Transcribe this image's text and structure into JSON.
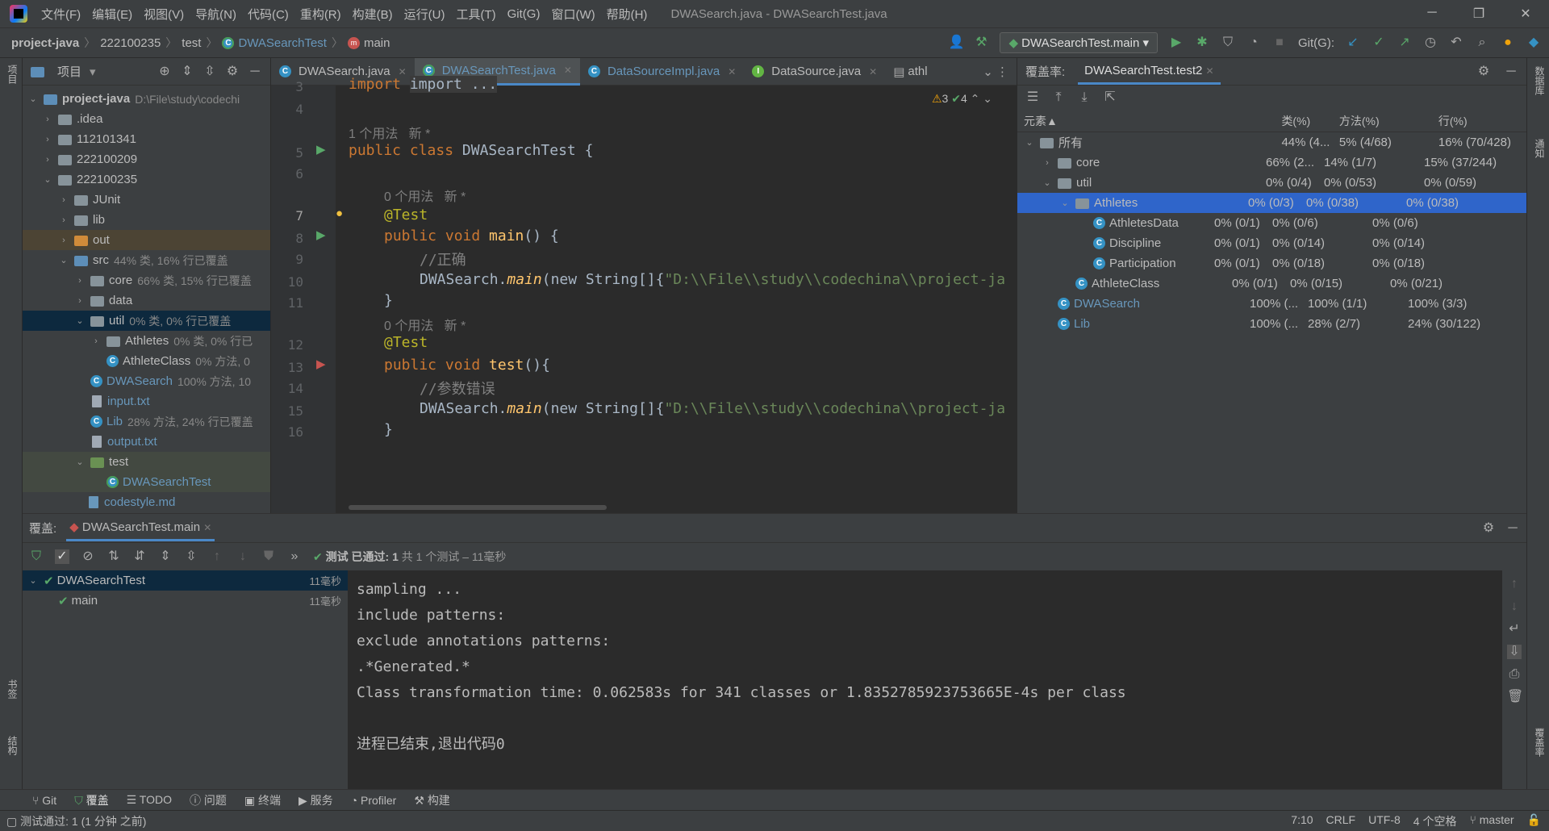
{
  "window": {
    "title": "DWASearch.java - DWASearchTest.java"
  },
  "menu": [
    "文件(F)",
    "编辑(E)",
    "视图(V)",
    "导航(N)",
    "代码(C)",
    "重构(R)",
    "构建(B)",
    "运行(U)",
    "工具(T)",
    "Git(G)",
    "窗口(W)",
    "帮助(H)"
  ],
  "breadcrumb": {
    "project": "project-java",
    "dir1": "222100235",
    "dir2": "test",
    "cls": "DWASearchTest",
    "method": "main"
  },
  "run_config": "DWASearchTest.main",
  "git_label": "Git(G):",
  "project_panel": {
    "title": "项目",
    "root": "project-java",
    "root_path": "D:\\File\\study\\codechi",
    "items": [
      {
        "label": ".idea",
        "note": ""
      },
      {
        "label": "112101341",
        "note": ""
      },
      {
        "label": "222100209",
        "note": ""
      },
      {
        "label": "222100235",
        "note": ""
      },
      {
        "label": "JUnit",
        "note": ""
      },
      {
        "label": "lib",
        "note": ""
      },
      {
        "label": "out",
        "note": ""
      },
      {
        "label": "src",
        "note": "44% 类, 16% 行已覆盖"
      },
      {
        "label": "core",
        "note": "66% 类, 15% 行已覆盖"
      },
      {
        "label": "data",
        "note": ""
      },
      {
        "label": "util",
        "note": "0% 类, 0% 行已覆盖"
      },
      {
        "label": "Athletes",
        "note": "0% 类, 0% 行已"
      },
      {
        "label": "AthleteClass",
        "note": "0% 方法, 0"
      },
      {
        "label": "DWASearch",
        "note": "100% 方法, 10"
      },
      {
        "label": "input.txt",
        "note": ""
      },
      {
        "label": "Lib",
        "note": "28% 方法, 24% 行已覆盖"
      },
      {
        "label": "output.txt",
        "note": ""
      },
      {
        "label": "test",
        "note": ""
      },
      {
        "label": "DWASearchTest",
        "note": ""
      },
      {
        "label": "codestyle.md",
        "note": ""
      }
    ]
  },
  "editor_tabs": [
    "DWASearch.java",
    "DWASearchTest.java",
    "DataSourceImpl.java",
    "DataSource.java",
    "athl"
  ],
  "inspections": {
    "warnings": "3",
    "ok": "4"
  },
  "code": {
    "l3": "import ...",
    "hint1": "1 个用法   新 *",
    "l5a": "public class ",
    "l5b": "DWASearchTest ",
    "l5c": "{",
    "hint2": "0 个用法   新 *",
    "l7": "@Test",
    "l8a": "public void ",
    "l8b": "main",
    "l8c": "() {",
    "l9": "//正确",
    "l10a": "DWASearch.",
    "l10b": "main",
    "l10c": "(new String[]{",
    "l10d": "\"D:\\\\File\\\\study\\\\codechina\\\\project-ja",
    "l11": "}",
    "hint3": "0 个用法   新 *",
    "l12": "@Test",
    "l13a": "public void ",
    "l13b": "test",
    "l13c": "(){",
    "l14": "//参数错误",
    "l15a": "DWASearch.",
    "l15b": "main",
    "l15c": "(new String[]{",
    "l15d": "\"D:\\\\File\\\\study\\\\codechina\\\\project-ja",
    "l16": "}",
    "lines": [
      "3",
      "4",
      "5",
      "6",
      "7",
      "8",
      "9",
      "10",
      "11",
      "12",
      "13",
      "14",
      "15",
      "16"
    ]
  },
  "coverage": {
    "label": "覆盖率:",
    "tab": "DWASearchTest.test2",
    "columns": [
      "元素",
      "类(%)",
      "方法(%)",
      "行(%)"
    ],
    "rows": [
      {
        "name": "所有",
        "cls": "44% (4...",
        "mth": "5% (4/68)",
        "line": "16% (70/428)"
      },
      {
        "name": "core",
        "cls": "66% (2...",
        "mth": "14% (1/7)",
        "line": "15% (37/244)"
      },
      {
        "name": "util",
        "cls": "0% (0/4)",
        "mth": "0% (0/53)",
        "line": "0% (0/59)"
      },
      {
        "name": "Athletes",
        "cls": "0% (0/3)",
        "mth": "0% (0/38)",
        "line": "0% (0/38)"
      },
      {
        "name": "AthletesData",
        "cls": "0% (0/1)",
        "mth": "0% (0/6)",
        "line": "0% (0/6)"
      },
      {
        "name": "Discipline",
        "cls": "0% (0/1)",
        "mth": "0% (0/14)",
        "line": "0% (0/14)"
      },
      {
        "name": "Participation",
        "cls": "0% (0/1)",
        "mth": "0% (0/18)",
        "line": "0% (0/18)"
      },
      {
        "name": "AthleteClass",
        "cls": "0% (0/1)",
        "mth": "0% (0/15)",
        "line": "0% (0/21)"
      },
      {
        "name": "DWASearch",
        "cls": "100% (...",
        "mth": "100% (1/1)",
        "line": "100% (3/3)"
      },
      {
        "name": "Lib",
        "cls": "100% (...",
        "mth": "28% (2/7)",
        "line": "24% (30/122)"
      }
    ]
  },
  "run_panel": {
    "label": "覆盖:",
    "tab": "DWASearchTest.main",
    "status_bold": "测试 已通过: 1",
    "status_rest": "共 1 个测试 – 11毫秒",
    "tests": [
      {
        "name": "DWASearchTest",
        "time": "11毫秒"
      },
      {
        "name": "main",
        "time": "11毫秒"
      }
    ]
  },
  "console": [
    "sampling ...",
    "include patterns:",
    "exclude annotations patterns:",
    ".*Generated.*",
    "Class transformation time: 0.062583s for 341 classes or 1.8352785923753665E-4s per class",
    "",
    "进程已结束,退出代码0"
  ],
  "tool_tabs": [
    "Git",
    "覆盖",
    "TODO",
    "问题",
    "终端",
    "服务",
    "Profiler",
    "构建"
  ],
  "status": {
    "left": "测试通过: 1 (1 分钟 之前)",
    "pos": "7:10",
    "eol": "CRLF",
    "enc": "UTF-8",
    "indent": "4 个空格",
    "branch": "master"
  },
  "side_labels": {
    "left_top": "项目",
    "left_b1": "书签",
    "left_b2": "结构",
    "right_top": "数据库",
    "right_mid": "通知",
    "right_bottom": "覆盖率"
  }
}
